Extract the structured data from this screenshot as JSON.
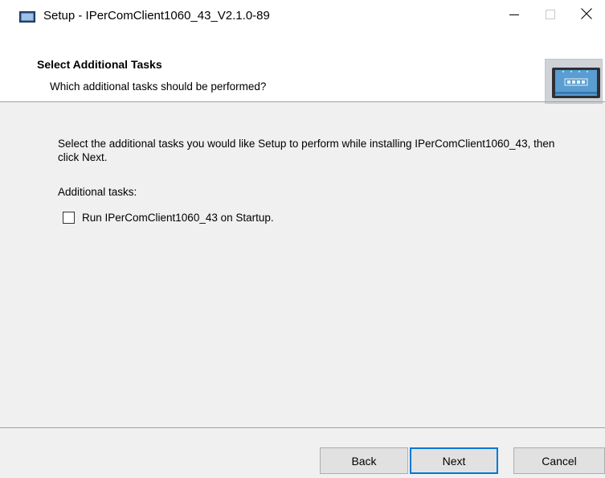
{
  "window": {
    "title": "Setup - IPerComClient1060_43_V2.1.0-89",
    "app_icon": "installer-icon",
    "controls": [
      "minimize-icon",
      "maximize-icon",
      "close-icon"
    ]
  },
  "header": {
    "title": "Select Additional Tasks",
    "subtitle": "Which additional tasks should be performed?"
  },
  "content": {
    "description": "Select the additional tasks you would like Setup to perform while installing IPerComClient1060_43, then click Next.",
    "tasks_label": "Additional tasks:",
    "tasks": [
      {
        "label": "Run IPerComClient1060_43 on Startup.",
        "checked": false
      }
    ]
  },
  "footer": {
    "back_label": "Back",
    "next_label": "Next",
    "cancel_label": "Cancel"
  },
  "colors": {
    "accent": "#0078d7",
    "background": "#f0f0f0",
    "header_bg": "#ffffff"
  }
}
